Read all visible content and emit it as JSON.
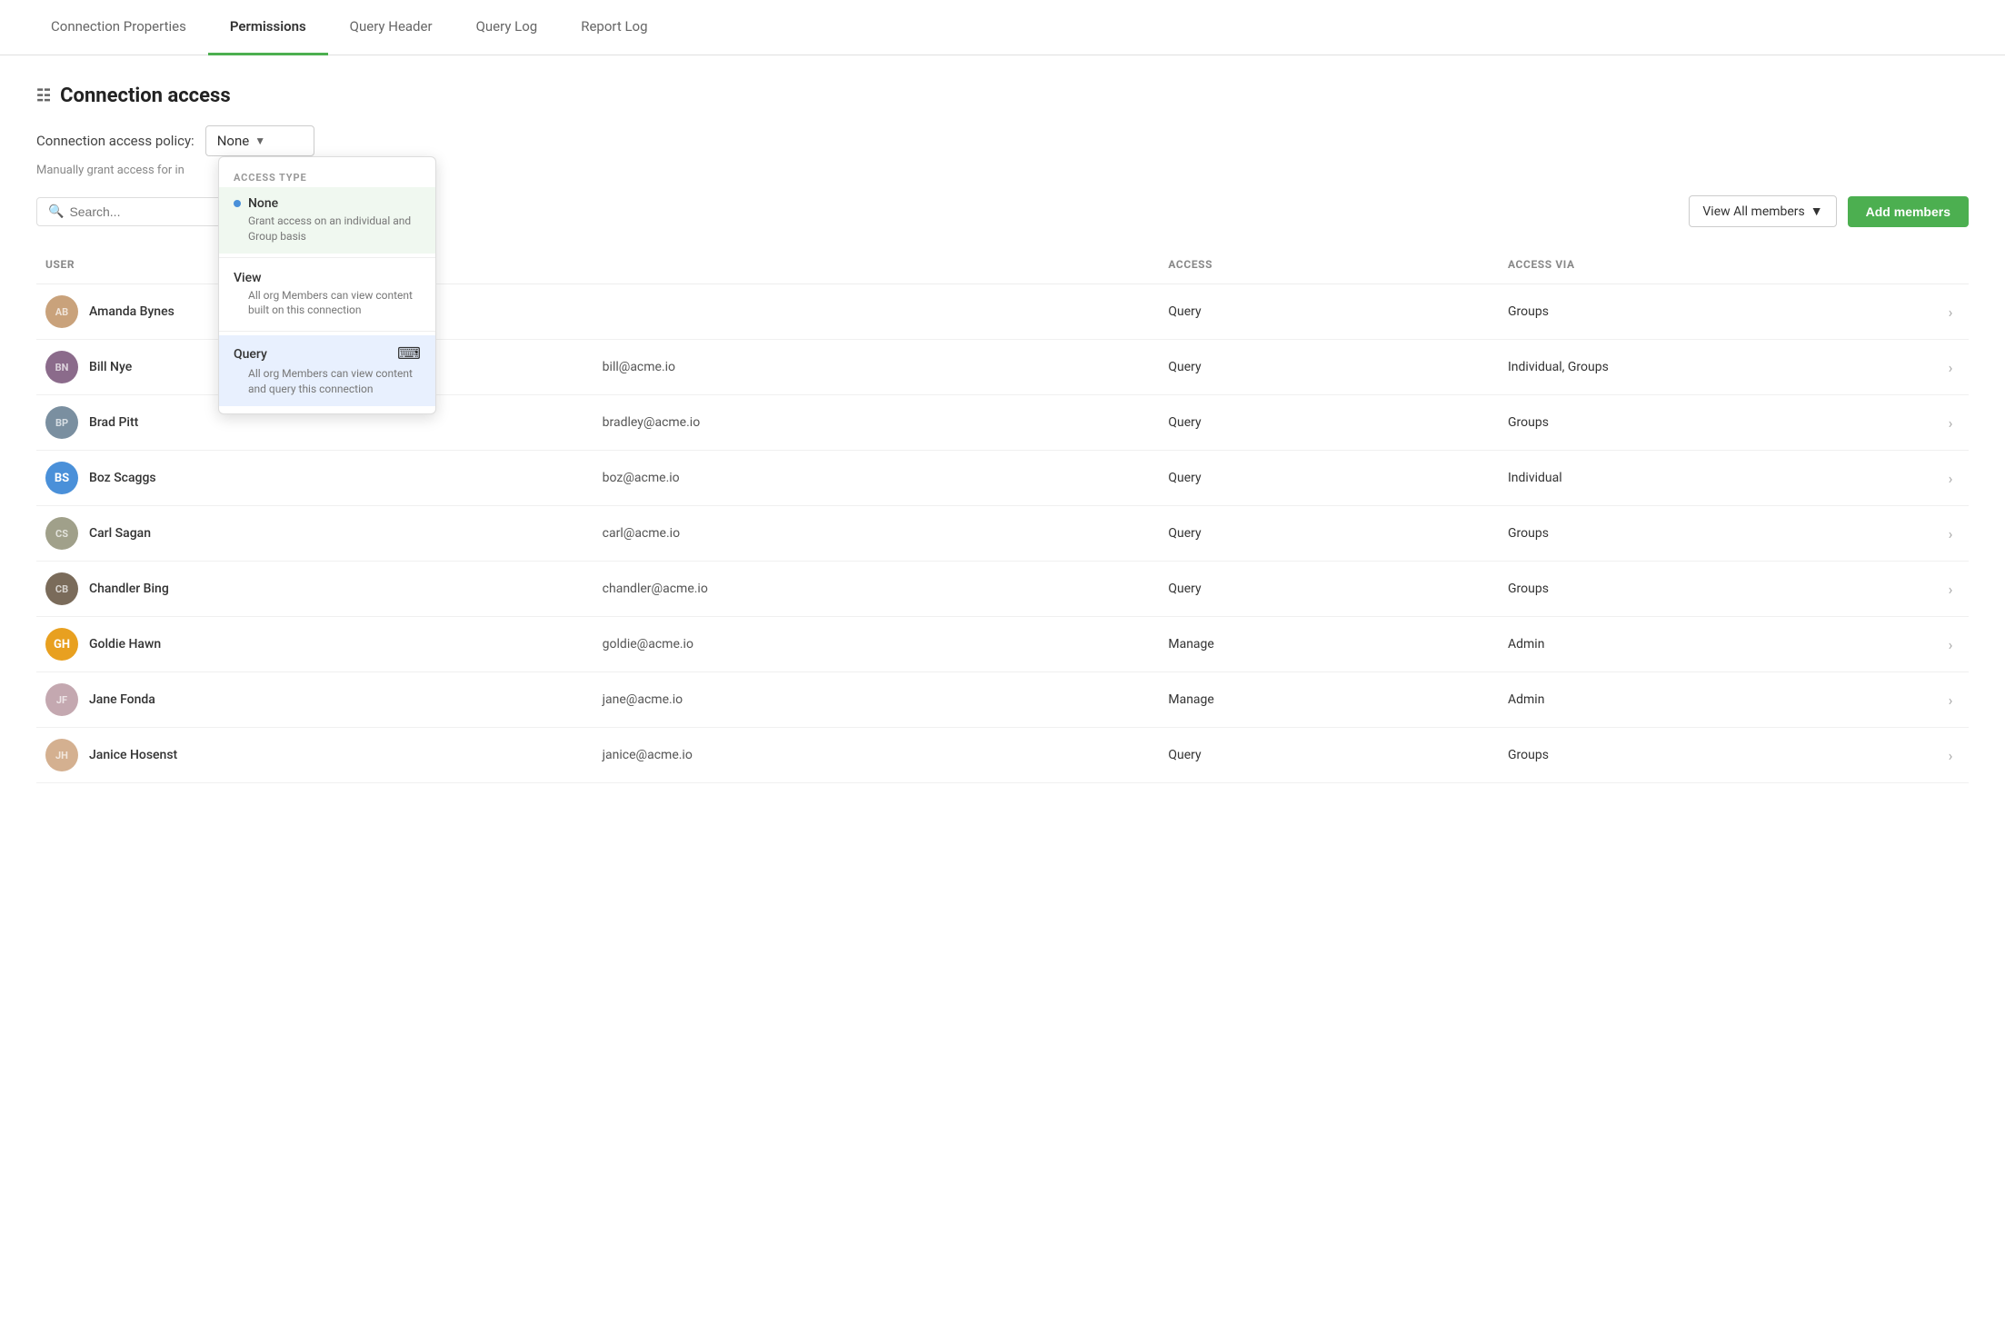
{
  "tabs": [
    {
      "id": "connection-properties",
      "label": "Connection Properties",
      "active": false
    },
    {
      "id": "permissions",
      "label": "Permissions",
      "active": true
    },
    {
      "id": "query-header",
      "label": "Query Header",
      "active": false
    },
    {
      "id": "query-log",
      "label": "Query Log",
      "active": false
    },
    {
      "id": "report-log",
      "label": "Report Log",
      "active": false
    }
  ],
  "section": {
    "title": "Connection access",
    "policy_label": "Connection access policy:",
    "policy_value": "None",
    "policy_sublabel": "Manually grant access for in"
  },
  "dropdown": {
    "section_label": "ACCESS TYPE",
    "items": [
      {
        "id": "none",
        "label": "None",
        "description": "Grant access on an individual and Group basis",
        "selected": true,
        "highlighted": false
      },
      {
        "id": "view",
        "label": "View",
        "description": "All org Members can view content built on this connection",
        "selected": false,
        "highlighted": false
      },
      {
        "id": "query",
        "label": "Query",
        "description": "All org Members can view content and query this connection",
        "selected": false,
        "highlighted": true
      }
    ]
  },
  "toolbar": {
    "search_placeholder": "Search...",
    "view_members_label": "View All members",
    "add_members_label": "Add members"
  },
  "table": {
    "columns": [
      "USER",
      "",
      "ACCESS",
      "ACCESS VIA",
      ""
    ],
    "rows": [
      {
        "name": "Amanda Bynes",
        "email": "",
        "access": "Query",
        "access_via": "Groups",
        "avatar_type": "img",
        "avatar_initials": "AB",
        "avatar_color": ""
      },
      {
        "name": "Bill Nye",
        "email": "bill@acme.io",
        "access": "Query",
        "access_via": "Individual, Groups",
        "avatar_type": "img",
        "avatar_initials": "BN",
        "avatar_color": ""
      },
      {
        "name": "Brad Pitt",
        "email": "bradley@acme.io",
        "access": "Query",
        "access_via": "Groups",
        "avatar_type": "img",
        "avatar_initials": "BP",
        "avatar_color": ""
      },
      {
        "name": "Boz Scaggs",
        "email": "boz@acme.io",
        "access": "Query",
        "access_via": "Individual",
        "avatar_type": "initials",
        "avatar_initials": "BS",
        "avatar_color": "#4a90d9"
      },
      {
        "name": "Carl Sagan",
        "email": "carl@acme.io",
        "access": "Query",
        "access_via": "Groups",
        "avatar_type": "img",
        "avatar_initials": "CS",
        "avatar_color": ""
      },
      {
        "name": "Chandler Bing",
        "email": "chandler@acme.io",
        "access": "Query",
        "access_via": "Groups",
        "avatar_type": "img",
        "avatar_initials": "CB",
        "avatar_color": ""
      },
      {
        "name": "Goldie Hawn",
        "email": "goldie@acme.io",
        "access": "Manage",
        "access_via": "Admin",
        "avatar_type": "initials",
        "avatar_initials": "GH",
        "avatar_color": "#e8a020"
      },
      {
        "name": "Jane Fonda",
        "email": "jane@acme.io",
        "access": "Manage",
        "access_via": "Admin",
        "avatar_type": "img",
        "avatar_initials": "JF",
        "avatar_color": ""
      },
      {
        "name": "Janice Hosenst",
        "email": "janice@acme.io",
        "access": "Query",
        "access_via": "Groups",
        "avatar_type": "img",
        "avatar_initials": "JH",
        "avatar_color": ""
      }
    ]
  },
  "colors": {
    "accent_green": "#4caf50",
    "tab_active_border": "#4caf50",
    "dot_blue": "#4a90d9",
    "dropdown_highlight_bg": "#e8f4e8"
  }
}
